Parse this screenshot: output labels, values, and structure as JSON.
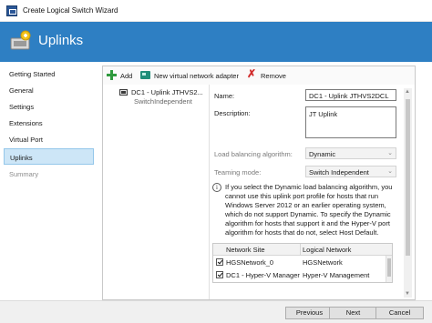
{
  "window": {
    "title": "Create Logical Switch Wizard"
  },
  "header": {
    "title": "Uplinks",
    "icon": "uplinks-wizard-icon"
  },
  "sidebar": {
    "items": [
      {
        "label": "Getting Started",
        "state": "normal"
      },
      {
        "label": "General",
        "state": "normal"
      },
      {
        "label": "Settings",
        "state": "normal"
      },
      {
        "label": "Extensions",
        "state": "normal"
      },
      {
        "label": "Virtual Port",
        "state": "normal"
      },
      {
        "label": "Uplinks",
        "state": "active"
      },
      {
        "label": "Summary",
        "state": "disabled"
      }
    ]
  },
  "toolbar": {
    "add_label": "Add",
    "new_adapter_label": "New virtual network adapter",
    "remove_label": "Remove"
  },
  "uplink_list": {
    "items": [
      {
        "name": "DC1 - Uplink JTHVS2...",
        "mode": "SwitchIndependent"
      }
    ]
  },
  "form": {
    "name_label": "Name:",
    "name_value": "DC1 - Uplink JTHVS2DCL",
    "description_label": "Description:",
    "description_value": "JT Uplink",
    "lb_label": "Load balancing algorithm:",
    "lb_value": "Dynamic",
    "teaming_label": "Teaming mode:",
    "teaming_value": "Switch Independent",
    "info_text": "If you select the Dynamic load balancing algorithm, you cannot use this uplink port profile for hosts that run Windows Server 2012 or an earlier operating system, which do not support Dynamic. To specify the Dynamic algorithm for hosts that support it and the Hyper-V port algorithm for hosts that do not, select Host Default."
  },
  "network_grid": {
    "headers": [
      "Network Site",
      "Logical Network"
    ],
    "rows": [
      {
        "site": "HGSNetwork_0",
        "network": "HGSNetwork",
        "checked": true
      },
      {
        "site": "DC1 - Hyper-V Manager",
        "network": "Hyper-V Management",
        "checked": true
      }
    ]
  },
  "footer": {
    "previous_label": "Previous",
    "next_label": "Next",
    "cancel_label": "Cancel"
  },
  "colors": {
    "header_bg": "#2e7fc3",
    "active_nav_bg": "#cde6f7",
    "add_icon": "#2f9a3e",
    "remove_icon": "#d12b2b"
  }
}
